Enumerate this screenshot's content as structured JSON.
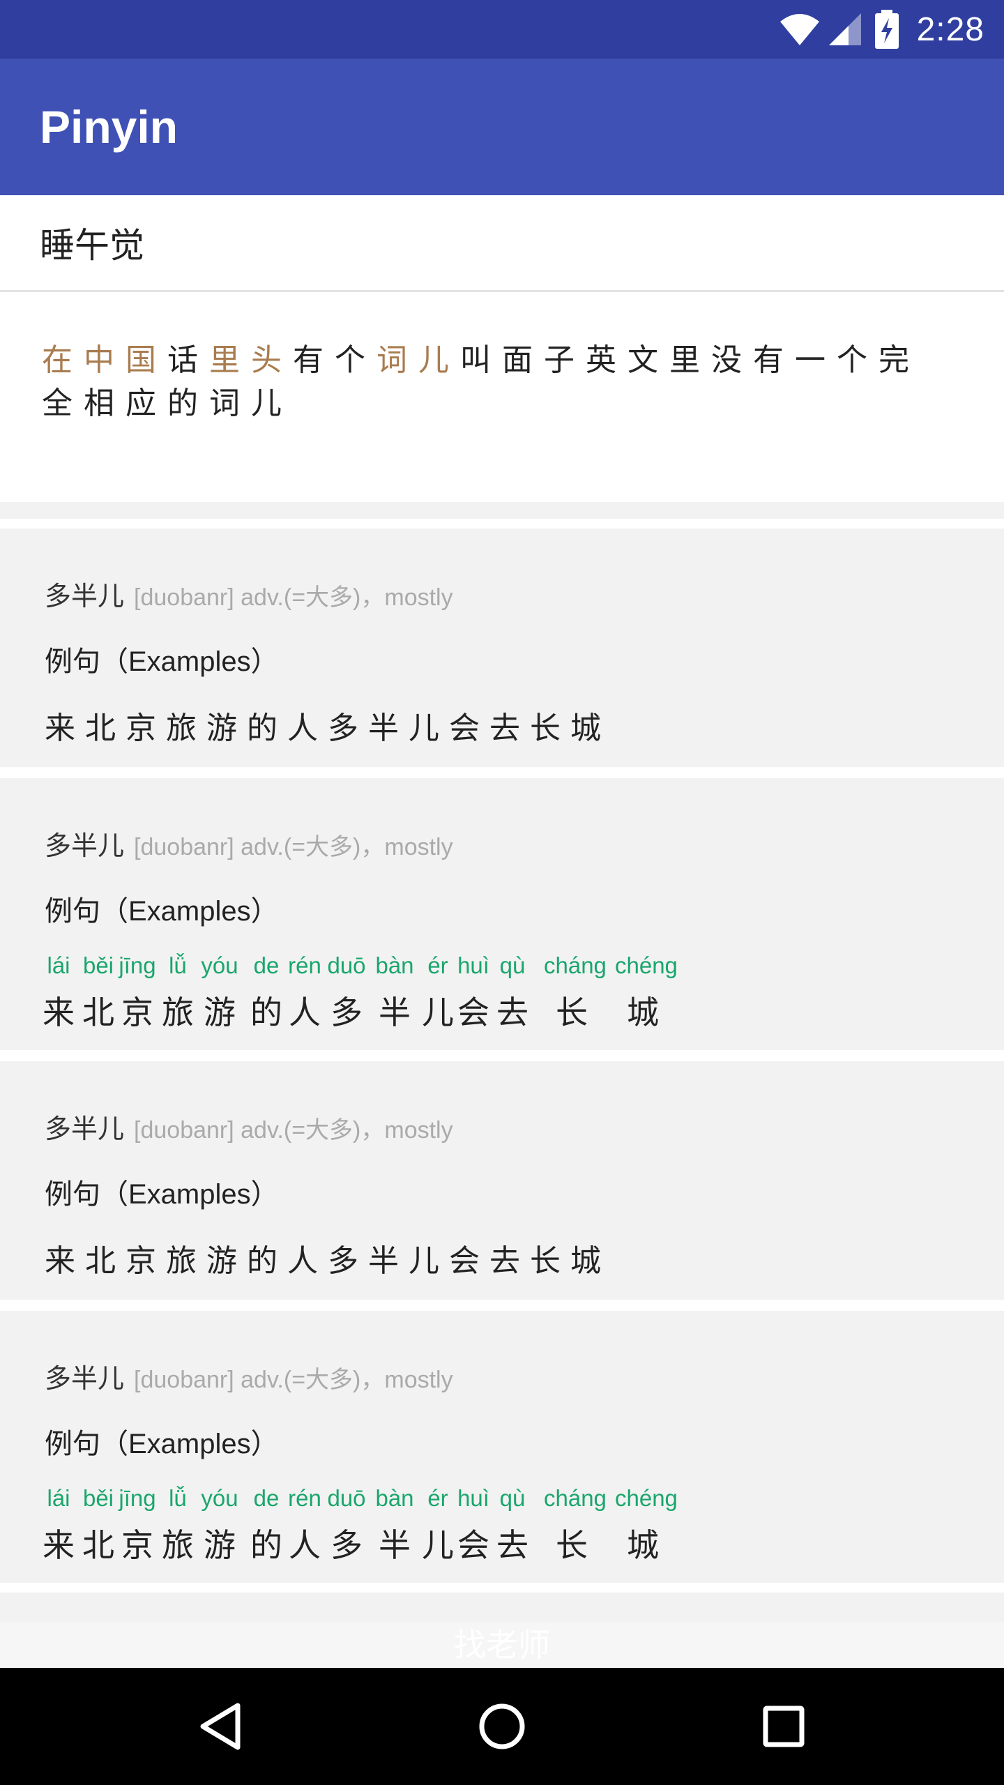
{
  "status_bar": {
    "time": "2:28",
    "icons": [
      "wifi-icon",
      "cell-signal-icon",
      "battery-charging-icon"
    ]
  },
  "app_bar": {
    "title": "Pinyin"
  },
  "search": {
    "value": "睡午觉",
    "placeholder": ""
  },
  "sentence": {
    "segments": [
      {
        "text": "在中国",
        "highlight": true
      },
      {
        "text": "话",
        "highlight": false
      },
      {
        "text": "里头",
        "highlight": true
      },
      {
        "text": "有个",
        "highlight": false
      },
      {
        "text": "词儿",
        "highlight": true
      },
      {
        "text": "叫面子英文里没有一个完全相应的词儿",
        "highlight": false
      }
    ]
  },
  "cards": [
    {
      "word": "多半儿",
      "meta": "[duobanr] adv.(=大多)，mostly",
      "examples_title_zh": "例句（",
      "examples_title_en": "Examples",
      "examples_title_end": "）",
      "show_pinyin": false,
      "sentence": "来北京旅游的人多半儿会去长城"
    },
    {
      "word": "多半儿",
      "meta": "[duobanr] adv.(=大多)，mostly",
      "examples_title_zh": "例句（",
      "examples_title_en": "Examples",
      "examples_title_end": "）",
      "show_pinyin": true,
      "ruby": [
        {
          "py": "lái",
          "hz": "来"
        },
        {
          "py": "běi",
          "hz": "北"
        },
        {
          "py": "jīng",
          "hz": "京"
        },
        {
          "py": "lǚ",
          "hz": "旅"
        },
        {
          "py": "yóu",
          "hz": "游"
        },
        {
          "py": "de",
          "hz": "的"
        },
        {
          "py": "rén",
          "hz": "人"
        },
        {
          "py": "duō",
          "hz": "多"
        },
        {
          "py": "bàn",
          "hz": "半"
        },
        {
          "py": "ér",
          "hz": "儿"
        },
        {
          "py": "huì",
          "hz": "会"
        },
        {
          "py": "qù",
          "hz": "去"
        },
        {
          "py": "cháng",
          "hz": "长"
        },
        {
          "py": "chéng",
          "hz": "城"
        }
      ]
    },
    {
      "word": "多半儿",
      "meta": "[duobanr] adv.(=大多)，mostly",
      "examples_title_zh": "例句（",
      "examples_title_en": "Examples",
      "examples_title_end": "）",
      "show_pinyin": false,
      "sentence": "来北京旅游的人多半儿会去长城"
    },
    {
      "word": "多半儿",
      "meta": "[duobanr] adv.(=大多)，mostly",
      "examples_title_zh": "例句（",
      "examples_title_en": "Examples",
      "examples_title_end": "）",
      "show_pinyin": true,
      "ruby": [
        {
          "py": "lái",
          "hz": "来"
        },
        {
          "py": "běi",
          "hz": "北"
        },
        {
          "py": "jīng",
          "hz": "京"
        },
        {
          "py": "lǚ",
          "hz": "旅"
        },
        {
          "py": "yóu",
          "hz": "游"
        },
        {
          "py": "de",
          "hz": "的"
        },
        {
          "py": "rén",
          "hz": "人"
        },
        {
          "py": "duō",
          "hz": "多"
        },
        {
          "py": "bàn",
          "hz": "半"
        },
        {
          "py": "ér",
          "hz": "儿"
        },
        {
          "py": "huì",
          "hz": "会"
        },
        {
          "py": "qù",
          "hz": "去"
        },
        {
          "py": "cháng",
          "hz": "长"
        },
        {
          "py": "chéng",
          "hz": "城"
        }
      ]
    }
  ],
  "footer": {
    "label": "找老师"
  },
  "nav_bar": {
    "buttons": [
      "back-icon",
      "home-icon",
      "recents-icon"
    ]
  },
  "colors": {
    "status_bar": "#303f9f",
    "app_bar": "#3f51b5",
    "highlight": "#a97c50",
    "pinyin": "#1aa66c",
    "card_bg": "#f2f2f2"
  }
}
